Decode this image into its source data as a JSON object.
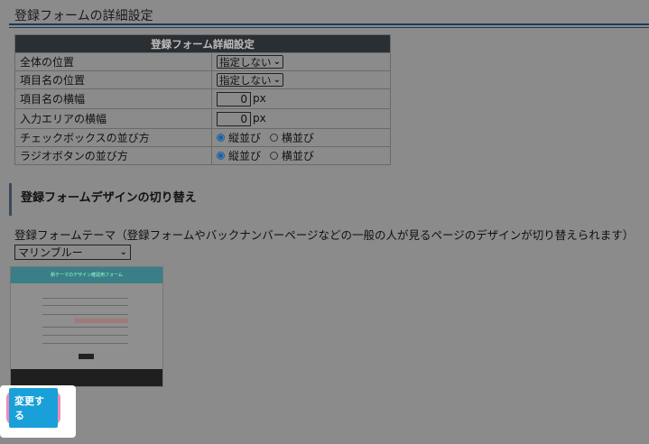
{
  "page": {
    "section_title": "登録フォームの詳細設定"
  },
  "settings_table": {
    "header": "登録フォーム詳細設定",
    "rows": [
      {
        "label": "全体の位置",
        "select_value": "指定しない"
      },
      {
        "label": "項目名の位置",
        "select_value": "指定しない"
      },
      {
        "label": "項目名の横幅",
        "number_value": "0",
        "unit": "px"
      },
      {
        "label": "入力エリアの横幅",
        "number_value": "0",
        "unit": "px"
      },
      {
        "label": "チェックボックスの並び方",
        "option_vertical": "縦並び",
        "option_horizontal": "横並び"
      },
      {
        "label": "ラジオボタンの並び方",
        "option_vertical": "縦並び",
        "option_horizontal": "横並び"
      }
    ]
  },
  "design": {
    "heading": "登録フォームデザインの切り替え",
    "theme_label": "登録フォームテーマ（登録フォームやバックナンバーページなどの一般の人が見るページのデザインが切り替えられます）",
    "theme_value": "マリンブルー",
    "preview_title": "新テーマのデザイン確認用フォーム"
  },
  "actions": {
    "change_button": "変更する"
  },
  "colors": {
    "overlay": "#8b8b8b",
    "table_header": "#2a2f33",
    "button": "#1aa0d8",
    "highlight_border": "#f08ab8",
    "accent_rule": "#1f3a57"
  }
}
